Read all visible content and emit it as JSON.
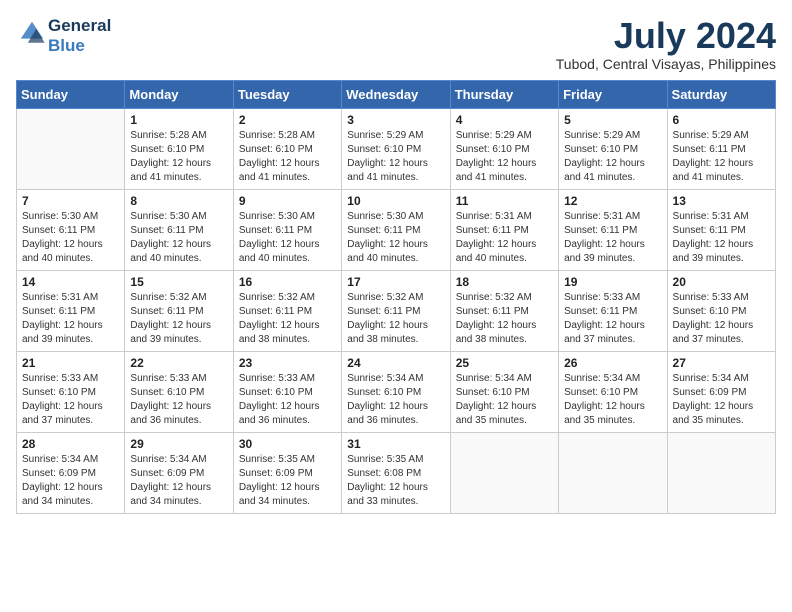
{
  "header": {
    "logo_line1": "General",
    "logo_line2": "Blue",
    "month_year": "July 2024",
    "location": "Tubod, Central Visayas, Philippines"
  },
  "days_of_week": [
    "Sunday",
    "Monday",
    "Tuesday",
    "Wednesday",
    "Thursday",
    "Friday",
    "Saturday"
  ],
  "weeks": [
    [
      {
        "day": "",
        "sunrise": "",
        "sunset": "",
        "daylight": ""
      },
      {
        "day": "1",
        "sunrise": "Sunrise: 5:28 AM",
        "sunset": "Sunset: 6:10 PM",
        "daylight": "Daylight: 12 hours and 41 minutes."
      },
      {
        "day": "2",
        "sunrise": "Sunrise: 5:28 AM",
        "sunset": "Sunset: 6:10 PM",
        "daylight": "Daylight: 12 hours and 41 minutes."
      },
      {
        "day": "3",
        "sunrise": "Sunrise: 5:29 AM",
        "sunset": "Sunset: 6:10 PM",
        "daylight": "Daylight: 12 hours and 41 minutes."
      },
      {
        "day": "4",
        "sunrise": "Sunrise: 5:29 AM",
        "sunset": "Sunset: 6:10 PM",
        "daylight": "Daylight: 12 hours and 41 minutes."
      },
      {
        "day": "5",
        "sunrise": "Sunrise: 5:29 AM",
        "sunset": "Sunset: 6:10 PM",
        "daylight": "Daylight: 12 hours and 41 minutes."
      },
      {
        "day": "6",
        "sunrise": "Sunrise: 5:29 AM",
        "sunset": "Sunset: 6:11 PM",
        "daylight": "Daylight: 12 hours and 41 minutes."
      }
    ],
    [
      {
        "day": "7",
        "sunrise": "Sunrise: 5:30 AM",
        "sunset": "Sunset: 6:11 PM",
        "daylight": "Daylight: 12 hours and 40 minutes."
      },
      {
        "day": "8",
        "sunrise": "Sunrise: 5:30 AM",
        "sunset": "Sunset: 6:11 PM",
        "daylight": "Daylight: 12 hours and 40 minutes."
      },
      {
        "day": "9",
        "sunrise": "Sunrise: 5:30 AM",
        "sunset": "Sunset: 6:11 PM",
        "daylight": "Daylight: 12 hours and 40 minutes."
      },
      {
        "day": "10",
        "sunrise": "Sunrise: 5:30 AM",
        "sunset": "Sunset: 6:11 PM",
        "daylight": "Daylight: 12 hours and 40 minutes."
      },
      {
        "day": "11",
        "sunrise": "Sunrise: 5:31 AM",
        "sunset": "Sunset: 6:11 PM",
        "daylight": "Daylight: 12 hours and 40 minutes."
      },
      {
        "day": "12",
        "sunrise": "Sunrise: 5:31 AM",
        "sunset": "Sunset: 6:11 PM",
        "daylight": "Daylight: 12 hours and 39 minutes."
      },
      {
        "day": "13",
        "sunrise": "Sunrise: 5:31 AM",
        "sunset": "Sunset: 6:11 PM",
        "daylight": "Daylight: 12 hours and 39 minutes."
      }
    ],
    [
      {
        "day": "14",
        "sunrise": "Sunrise: 5:31 AM",
        "sunset": "Sunset: 6:11 PM",
        "daylight": "Daylight: 12 hours and 39 minutes."
      },
      {
        "day": "15",
        "sunrise": "Sunrise: 5:32 AM",
        "sunset": "Sunset: 6:11 PM",
        "daylight": "Daylight: 12 hours and 39 minutes."
      },
      {
        "day": "16",
        "sunrise": "Sunrise: 5:32 AM",
        "sunset": "Sunset: 6:11 PM",
        "daylight": "Daylight: 12 hours and 38 minutes."
      },
      {
        "day": "17",
        "sunrise": "Sunrise: 5:32 AM",
        "sunset": "Sunset: 6:11 PM",
        "daylight": "Daylight: 12 hours and 38 minutes."
      },
      {
        "day": "18",
        "sunrise": "Sunrise: 5:32 AM",
        "sunset": "Sunset: 6:11 PM",
        "daylight": "Daylight: 12 hours and 38 minutes."
      },
      {
        "day": "19",
        "sunrise": "Sunrise: 5:33 AM",
        "sunset": "Sunset: 6:11 PM",
        "daylight": "Daylight: 12 hours and 37 minutes."
      },
      {
        "day": "20",
        "sunrise": "Sunrise: 5:33 AM",
        "sunset": "Sunset: 6:10 PM",
        "daylight": "Daylight: 12 hours and 37 minutes."
      }
    ],
    [
      {
        "day": "21",
        "sunrise": "Sunrise: 5:33 AM",
        "sunset": "Sunset: 6:10 PM",
        "daylight": "Daylight: 12 hours and 37 minutes."
      },
      {
        "day": "22",
        "sunrise": "Sunrise: 5:33 AM",
        "sunset": "Sunset: 6:10 PM",
        "daylight": "Daylight: 12 hours and 36 minutes."
      },
      {
        "day": "23",
        "sunrise": "Sunrise: 5:33 AM",
        "sunset": "Sunset: 6:10 PM",
        "daylight": "Daylight: 12 hours and 36 minutes."
      },
      {
        "day": "24",
        "sunrise": "Sunrise: 5:34 AM",
        "sunset": "Sunset: 6:10 PM",
        "daylight": "Daylight: 12 hours and 36 minutes."
      },
      {
        "day": "25",
        "sunrise": "Sunrise: 5:34 AM",
        "sunset": "Sunset: 6:10 PM",
        "daylight": "Daylight: 12 hours and 35 minutes."
      },
      {
        "day": "26",
        "sunrise": "Sunrise: 5:34 AM",
        "sunset": "Sunset: 6:10 PM",
        "daylight": "Daylight: 12 hours and 35 minutes."
      },
      {
        "day": "27",
        "sunrise": "Sunrise: 5:34 AM",
        "sunset": "Sunset: 6:09 PM",
        "daylight": "Daylight: 12 hours and 35 minutes."
      }
    ],
    [
      {
        "day": "28",
        "sunrise": "Sunrise: 5:34 AM",
        "sunset": "Sunset: 6:09 PM",
        "daylight": "Daylight: 12 hours and 34 minutes."
      },
      {
        "day": "29",
        "sunrise": "Sunrise: 5:34 AM",
        "sunset": "Sunset: 6:09 PM",
        "daylight": "Daylight: 12 hours and 34 minutes."
      },
      {
        "day": "30",
        "sunrise": "Sunrise: 5:35 AM",
        "sunset": "Sunset: 6:09 PM",
        "daylight": "Daylight: 12 hours and 34 minutes."
      },
      {
        "day": "31",
        "sunrise": "Sunrise: 5:35 AM",
        "sunset": "Sunset: 6:08 PM",
        "daylight": "Daylight: 12 hours and 33 minutes."
      },
      {
        "day": "",
        "sunrise": "",
        "sunset": "",
        "daylight": ""
      },
      {
        "day": "",
        "sunrise": "",
        "sunset": "",
        "daylight": ""
      },
      {
        "day": "",
        "sunrise": "",
        "sunset": "",
        "daylight": ""
      }
    ]
  ]
}
